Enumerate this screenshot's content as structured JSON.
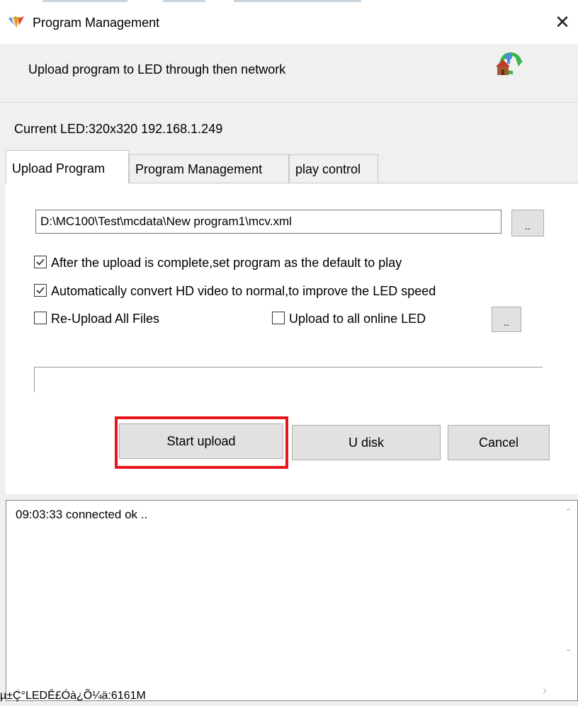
{
  "window": {
    "title": "Program Management",
    "close_symbol": "✕"
  },
  "banner": {
    "text": "Upload program to LED  through then network"
  },
  "current_led": "Current LED:320x320 192.168.1.249",
  "tabs": [
    {
      "label": "Upload Program",
      "active": true
    },
    {
      "label": "Program Management",
      "active": false
    },
    {
      "label": "play control",
      "active": false
    }
  ],
  "upload": {
    "path_value": "D:\\MC100\\Test\\mcdata\\New program1\\mcv.xml",
    "browse_label": "..",
    "browse2_label": "..",
    "checkboxes": [
      {
        "label": "After the upload is complete,set program as the default to play",
        "checked": true
      },
      {
        "label": "Automatically convert HD video to normal,to improve the LED speed",
        "checked": true
      },
      {
        "label": "Re-Upload All Files",
        "checked": false
      },
      {
        "label": "Upload to all online LED",
        "checked": false
      }
    ],
    "progress": 0
  },
  "buttons": {
    "start_upload": "Start upload",
    "u_disk": "U disk",
    "cancel": "Cancel"
  },
  "log": {
    "lines": [
      "09:03:33  connected ok .."
    ]
  },
  "status_text": "µ±Ç°LEDÊ£Óà¿Õ¼ä:6161M",
  "colors": {
    "highlight": "#e8161a",
    "window_bg": "#f0f0f0",
    "button_bg": "#e1e1e1"
  }
}
